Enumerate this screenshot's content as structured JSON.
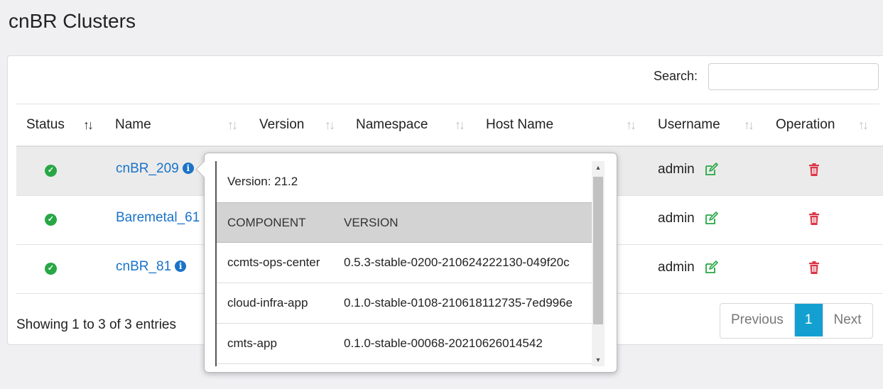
{
  "page": {
    "title": "cnBR Clusters"
  },
  "search": {
    "label": "Search:",
    "placeholder": "",
    "value": ""
  },
  "columns": {
    "status": "Status",
    "name": "Name",
    "version": "Version",
    "namespace": "Namespace",
    "host_name": "Host Name",
    "username": "Username",
    "operation": "Operation"
  },
  "sort_glyph": "↑↓",
  "rows": [
    {
      "status": "ok",
      "name": "cnBR_209",
      "username": "admin"
    },
    {
      "status": "ok",
      "name": "Baremetal_61",
      "username": "admin"
    },
    {
      "status": "ok",
      "name": "cnBR_81",
      "username": "admin"
    }
  ],
  "footer": {
    "showing": "Showing 1 to 3 of 3 entries",
    "previous": "Previous",
    "current_page": "1",
    "next": "Next"
  },
  "popover": {
    "version": "Version: 21.2",
    "headers": {
      "component": "COMPONENT",
      "version": "VERSION"
    },
    "components": [
      {
        "component": "ccmts-ops-center",
        "version": "0.5.3-stable-0200-210624222130-049f20c"
      },
      {
        "component": "cloud-infra-app",
        "version": "0.1.0-stable-0108-210618112735-7ed996e"
      },
      {
        "component": "cmts-app",
        "version": "0.1.0-stable-00068-20210626014542"
      }
    ]
  },
  "colors": {
    "link": "#1a73c9",
    "success": "#28a745",
    "danger": "#dc3545",
    "edit": "#28a745",
    "page_active": "#13a0d1"
  },
  "icons": {
    "status": "check-circle-icon",
    "info": "info-circle-icon",
    "edit": "edit-icon",
    "delete": "trash-icon"
  }
}
